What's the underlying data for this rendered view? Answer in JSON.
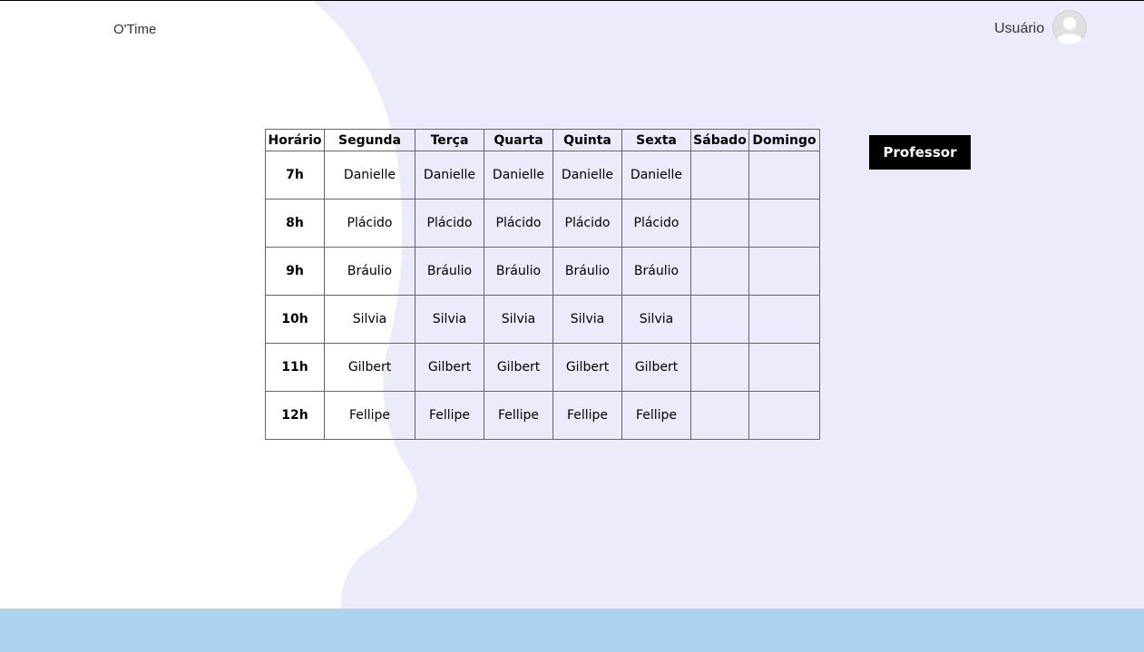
{
  "header": {
    "brand": "O'Time",
    "user_label": "Usuário"
  },
  "icons": {
    "avatar": "user-avatar-icon"
  },
  "colors": {
    "background_shape": "#ecebfb",
    "footer": "#acd3ef",
    "button_bg": "#000000",
    "button_text": "#ffffff"
  },
  "schedule": {
    "headers": [
      "Horário",
      "Segunda",
      "Terça",
      "Quarta",
      "Quinta",
      "Sexta",
      "Sábado",
      "Domingo"
    ],
    "rows": [
      {
        "hour": "7h",
        "cells": [
          "Danielle",
          "Danielle",
          "Danielle",
          "Danielle",
          "Danielle",
          "",
          ""
        ]
      },
      {
        "hour": "8h",
        "cells": [
          "Plácido",
          "Plácido",
          "Plácido",
          "Plácido",
          "Plácido",
          "",
          ""
        ]
      },
      {
        "hour": "9h",
        "cells": [
          "Bráulio",
          "Bráulio",
          "Bráulio",
          "Bráulio",
          "Bráulio",
          "",
          ""
        ]
      },
      {
        "hour": "10h",
        "cells": [
          "Silvia",
          "Silvia",
          "Silvia",
          "Silvia",
          "Silvia",
          "",
          ""
        ]
      },
      {
        "hour": "11h",
        "cells": [
          "Gilbert",
          "Gilbert",
          "Gilbert",
          "Gilbert",
          "Gilbert",
          "",
          ""
        ]
      },
      {
        "hour": "12h",
        "cells": [
          "Fellipe",
          "Fellipe",
          "Fellipe",
          "Fellipe",
          "Fellipe",
          "",
          ""
        ]
      }
    ]
  },
  "actions": {
    "professor_label": "Professor"
  }
}
